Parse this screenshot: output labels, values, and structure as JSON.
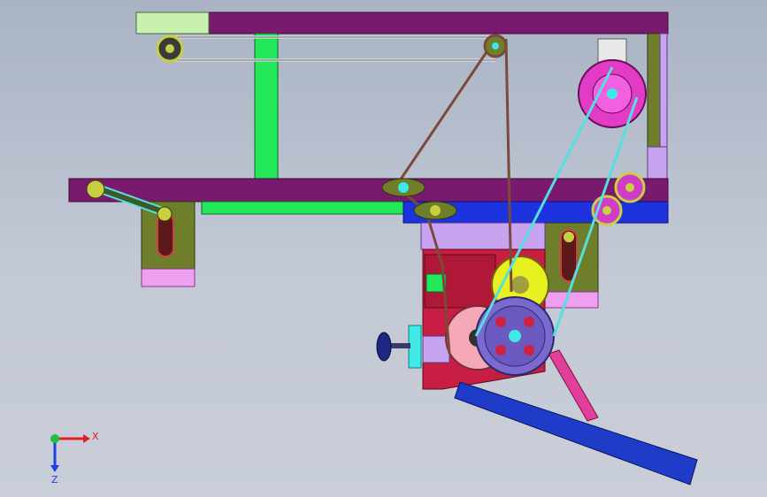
{
  "viewport": {
    "background_top": "#a9b3c4",
    "background_bottom": "#c9ced8"
  },
  "model": {
    "frame_color": "#7a1a6e",
    "green_member_color": "#22e85a",
    "blue_block_color": "#1e33e0",
    "olive_bracket_color": "#6e7e2a",
    "pink_pad_color": "#ef9ff0",
    "gearbox_color": "#c81e44",
    "light_green_pad_color": "#c8f0b0",
    "lavender_pad_color": "#c8a4f0",
    "motor_color": "#e23cc6",
    "motor_cap_color": "#e8e8e8",
    "belt_brown_color": "#7a4a3a",
    "belt_cyan_color": "#55e0e0",
    "pulley_color": "#7a6ad0",
    "yellow_gear_color": "#e8f020",
    "magenta_gear_color": "#d23ac8",
    "salmon_gear_color": "#f4a8b8",
    "conveyor_color": "#1e3cc8",
    "strut_color": "#e0409a",
    "handwheel_color": "#1e2880",
    "cyan_shaft_color": "#40e8e8"
  },
  "triad": {
    "x_label": "X",
    "z_label": "Z",
    "x_axis_color": "#e02020",
    "y_axis_color": "#20c040",
    "z_axis_color": "#2040e0"
  }
}
